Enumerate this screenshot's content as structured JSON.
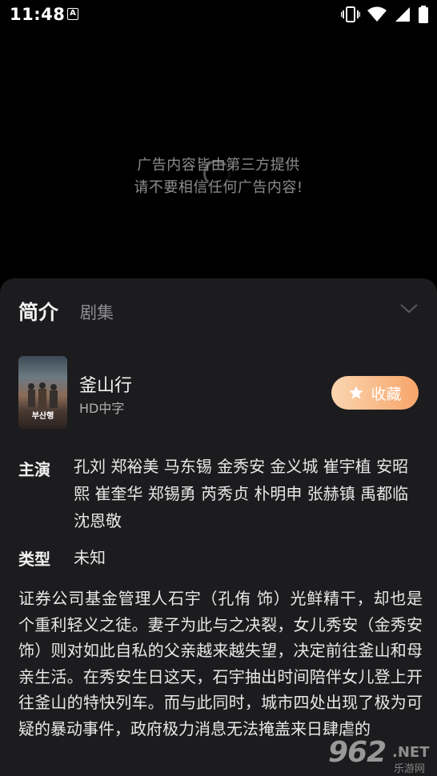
{
  "status_bar": {
    "time": "11:48",
    "a_badge": "A"
  },
  "player": {
    "ad_line1": "广告内容皆由第三方提供",
    "ad_line2": "请不要相信任何广告内容!"
  },
  "tabs": {
    "intro": "简介",
    "episodes": "剧集"
  },
  "movie": {
    "title": "釜山行",
    "quality": "HD中字",
    "poster_text": "부산행"
  },
  "favorite": {
    "label": "收藏",
    "color_start": "#fbd5b0",
    "color_end": "#f7a56a"
  },
  "details": {
    "cast_label": "主演",
    "cast": "孔刘 郑裕美 马东锡 金秀安 金义城 崔宇植 安昭熙 崔奎华 郑锡勇 芮秀贞 朴明申 张赫镇 禹都临 沈恩敬",
    "type_label": "类型",
    "type_value": "未知",
    "synopsis": "证券公司基金管理人石宇（孔侑 饰）光鲜精干，却也是个重利轻义之徒。妻子为此与之决裂，女儿秀安（金秀安 饰）则对如此自私的父亲越来越失望，决定前往釜山和母亲生活。在秀安生日这天，石宇抽出时间陪伴女儿登上开往釜山的特快列车。而与此同时，城市四处出现了极为可疑的暴动事件，政府极力消息无法掩盖来日肆虐的"
  },
  "watermark": {
    "main": "962",
    "net": ".NET",
    "sub": "乐游网"
  }
}
